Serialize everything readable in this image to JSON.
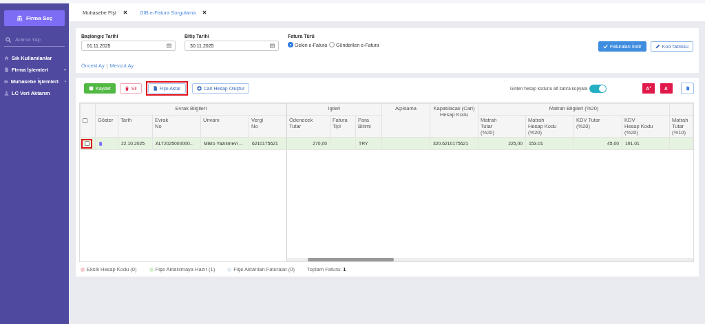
{
  "sidebar": {
    "company_button": "Firma Seç",
    "search": {
      "placeholder": "Arama Yap"
    },
    "items": [
      {
        "label": "Sık Kullanılanlar",
        "has_submenu": false
      },
      {
        "label": "Firma İşlemleri",
        "has_submenu": true
      },
      {
        "label": "Muhasebe İşlemleri",
        "has_submenu": true
      },
      {
        "label": "LC Veri Aktarım",
        "has_submenu": false
      }
    ]
  },
  "tabs": [
    {
      "label": "Muhasebe Fişi",
      "selected": false
    },
    {
      "label": "GİB e-Fatura Sorgulama",
      "selected": true
    }
  ],
  "filters": {
    "start_date": {
      "label": "Başlangıç Tarihi",
      "value": "01.11.2025"
    },
    "end_date": {
      "label": "Bitiş Tarihi",
      "value": "30.11.2025"
    },
    "invoice_type": {
      "label": "Fatura Türü",
      "options": [
        {
          "label": "Gelen e-Fatura",
          "selected": true
        },
        {
          "label": "Gönderilen e-Fatura",
          "selected": false
        }
      ]
    },
    "quick_links": [
      "Önceki Ay",
      "Mevcut Ay"
    ],
    "quick_link_separator": "|",
    "buttons": [
      {
        "label": "Faturaları İndir",
        "kind": "primary"
      },
      {
        "label": "Kod Tablosu",
        "kind": "outline"
      }
    ]
  },
  "toolbar": {
    "buttons": [
      {
        "label": "Kaydet",
        "kind": "success",
        "highlighted": false
      },
      {
        "label": "Sil",
        "kind": "danger",
        "highlighted": false
      },
      {
        "label": "Fişe Aktar",
        "kind": "transfer",
        "highlighted": true
      },
      {
        "label": "Cari Hesap Oluştur",
        "kind": "create",
        "highlighted": false
      }
    ],
    "copy_toggle": {
      "label": "Girilen hesap kodunu alt satıra kopyala",
      "on": true
    },
    "font_buttons": [
      "A$^{+}$",
      "A$^{-}$"
    ]
  },
  "table": {
    "groups": [
      {
        "kind": "group",
        "title": "Evrak Bilgileri",
        "columns": [
          "Göster",
          "Tarih",
          "Evrak\nNo",
          "Unvanı",
          "Vergi\nNo"
        ]
      },
      {
        "kind": "group",
        "title": "lgileri",
        "columns": [
          "Ödenecek\nTutar",
          "Fatura\nTipi",
          "Para\nBirimi"
        ]
      },
      {
        "kind": "merged",
        "columns": [
          "Açıklama"
        ]
      },
      {
        "kind": "merged",
        "columns": [
          "Kapatılacak (Cari)\nHesap Kodu"
        ]
      },
      {
        "kind": "group",
        "title": "Matrah Bilgileri (%20)",
        "columns": [
          "Matrah\nTutar\n(%20)",
          "Matrah\nHesap Kodu\n(%20)",
          "KDV Tutar\n(%20)",
          "KDV\nHesap Kodu\n(%20)"
        ]
      },
      {
        "kind": "group",
        "columns": [
          "Matrah\nTutar\n(%10)"
        ]
      }
    ],
    "header_checked": false,
    "rows": [
      {
        "checked": false,
        "highlighted": true,
        "color": "#e6f3e0",
        "cells": [
          "22.10.2025",
          "ALT2025000000...",
          "Mikro Yazılımevi ...",
          "6210175621",
          "270,00",
          null,
          "TRY",
          null,
          "320.6210175621",
          "225,00",
          "153.01",
          "45,00",
          "191.01",
          null
        ]
      }
    ]
  },
  "legend": [
    {
      "label": "Eksik Hesap Kodu (0)",
      "color": "#f6c9d0"
    },
    {
      "label": "Fişe Aktarılmaya Hazır (1)",
      "color": "#d5eecb"
    },
    {
      "label": "Fişe Aktarılan Faturalar (0)",
      "color": "#e4ecf6"
    }
  ],
  "total": {
    "label": "Toplam Fatura:",
    "value": "1"
  }
}
